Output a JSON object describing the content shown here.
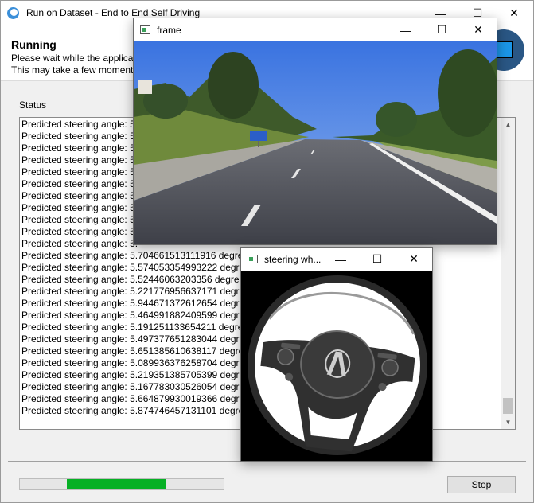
{
  "main_window": {
    "title": "Run on Dataset - End to End Self Driving",
    "controls": {
      "minimize": "—",
      "maximize": "☐",
      "close": "✕"
    },
    "header": {
      "status_title": "Running",
      "message_line1": "Please wait while the applicat",
      "message_line2": "This may take a few moments"
    },
    "status_label": "Status",
    "status_lines": [
      "Predicted steering angle: 5.",
      "Predicted steering angle: 5.",
      "Predicted steering angle: 5.",
      "Predicted steering angle: 5.",
      "Predicted steering angle: 5.",
      "Predicted steering angle: 5.",
      "Predicted steering angle: 5.",
      "Predicted steering angle: 5.",
      "Predicted steering angle: 5.",
      "Predicted steering angle: 5.",
      "Predicted steering angle: 5.",
      "Predicted steering angle: 5.704661513111916 degrees",
      "Predicted steering angle: 5.574053354993222 degrees",
      "Predicted steering angle: 5.52446063203356 degrees",
      "Predicted steering angle: 5.221776956637171 degrees",
      "Predicted steering angle: 5.944671372612654 degrees",
      "Predicted steering angle: 5.464991882409599 degrees",
      "Predicted steering angle: 5.191251133654211 degrees",
      "Predicted steering angle: 5.497377651283044 degrees",
      "Predicted steering angle: 5.651385610638117 degrees",
      "Predicted steering angle: 5.089936376258704 degrees",
      "Predicted steering angle: 5.219351385705399 degrees",
      "Predicted steering angle: 5.167783030526054 degrees",
      "Predicted steering angle: 5.664879930019366 degrees",
      "Predicted steering angle: 5.874746457131101 degrees"
    ],
    "progress_fraction": 0.49,
    "progress_start_fraction": 0.23,
    "stop_label": "Stop"
  },
  "frame_window": {
    "title": "frame",
    "controls": {
      "minimize": "—",
      "maximize": "☐",
      "close": "✕"
    }
  },
  "wheel_window": {
    "title": "steering wh...",
    "controls": {
      "minimize": "—",
      "maximize": "☐",
      "close": "✕"
    }
  },
  "colors": {
    "progress_fill": "#06b025",
    "sky": "#4d86e6",
    "road": "#4a4d55",
    "app_icon": "#3b8fd9"
  }
}
